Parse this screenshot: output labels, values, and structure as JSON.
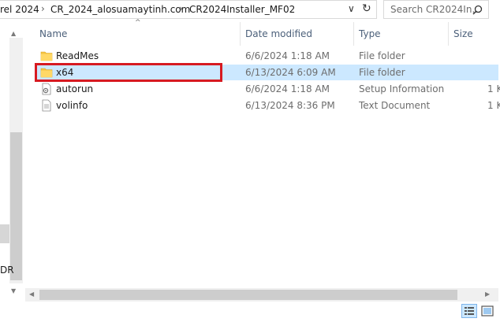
{
  "address_bar": {
    "crumbs": [
      "rel 2024",
      "CR_2024_alosuamaytinh.com",
      "CR2024Installer_MF02"
    ],
    "separator": "›",
    "dropdown_glyph": "∨",
    "refresh_glyph": "↻"
  },
  "search": {
    "placeholder": "Search CR2024In...",
    "icon": "search-icon"
  },
  "nav": {
    "fragment_text": "DR"
  },
  "columns": {
    "name": "Name",
    "date_modified": "Date modified",
    "type": "Type",
    "size": "Size"
  },
  "files": [
    {
      "name": "ReadMes",
      "date": "6/6/2024 1:18 AM",
      "type": "File folder",
      "size": "",
      "icon": "folder-icon",
      "selected": false
    },
    {
      "name": "x64",
      "date": "6/13/2024 6:09 AM",
      "type": "File folder",
      "size": "",
      "icon": "folder-icon",
      "selected": true
    },
    {
      "name": "autorun",
      "date": "6/6/2024 1:18 AM",
      "type": "Setup Information",
      "size": "1 K",
      "icon": "setup-info-file-icon",
      "selected": false
    },
    {
      "name": "volinfo",
      "date": "6/13/2024 8:36 PM",
      "type": "Text Document",
      "size": "1 K",
      "icon": "text-document-icon",
      "selected": false
    }
  ],
  "colors": {
    "selection": "#cce8ff",
    "highlight_box": "#d71a21",
    "header_text": "#4c607a",
    "folder": "#f5c342"
  }
}
